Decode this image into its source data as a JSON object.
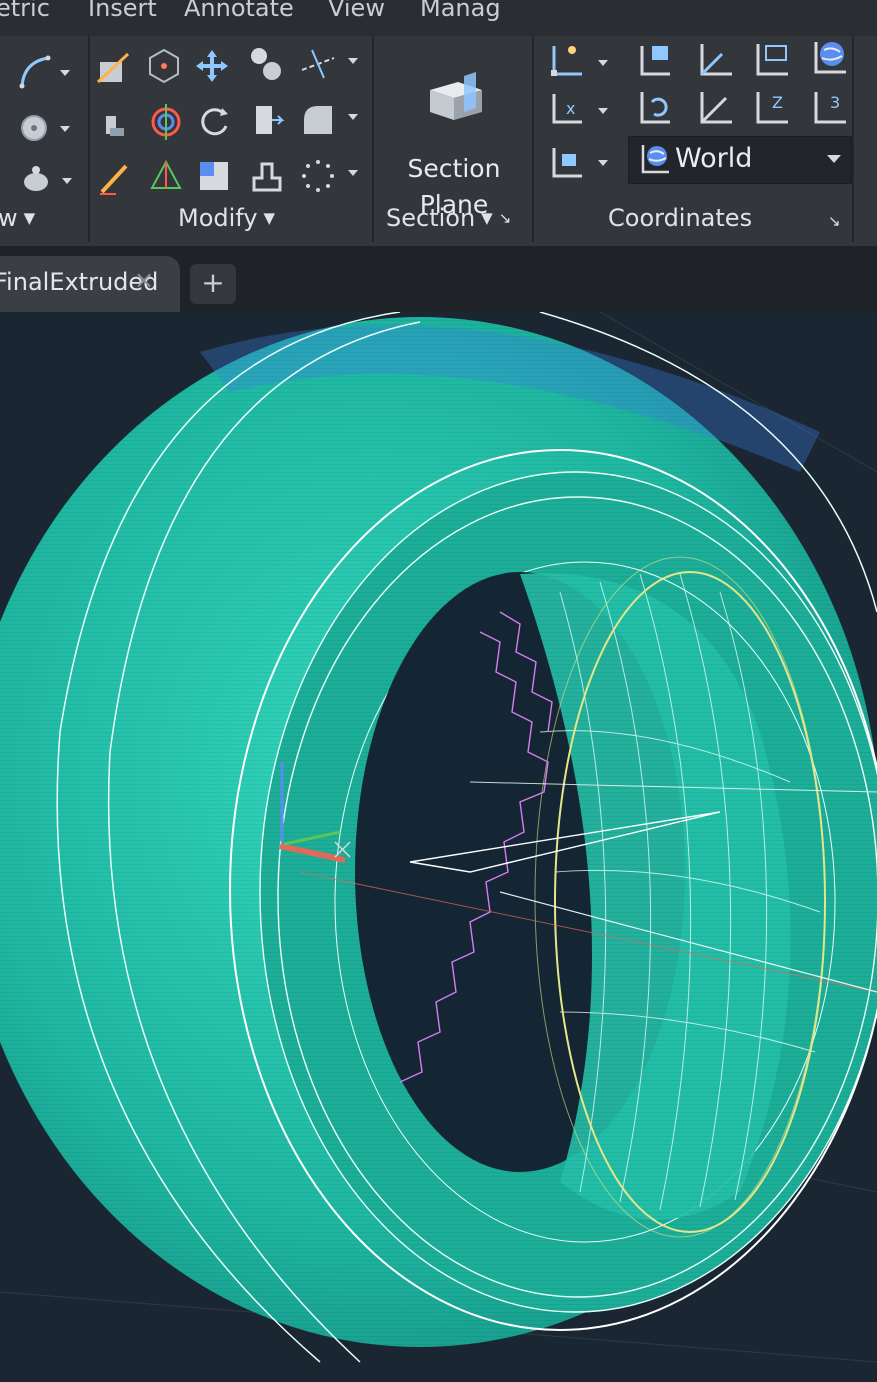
{
  "menu": {
    "tabs": [
      "etric",
      "Insert",
      "Annotate",
      "View",
      "Manag"
    ]
  },
  "ribbon": {
    "panels": {
      "view_partial": "w",
      "modify": "Modify",
      "section": "Section",
      "coordinates": "Coordinates"
    },
    "section_plane": {
      "line1": "Section",
      "line2": "Plane"
    },
    "ucs_select": {
      "value": "World"
    }
  },
  "document": {
    "tab_name": "FinalExtruded",
    "close_glyph": "×",
    "new_tab_glyph": "+"
  },
  "colors": {
    "tire_fill": "#1fb8a2",
    "wire": "#e8fff8",
    "accent_yellow": "#e5e58a",
    "accent_magenta": "#d77cf0",
    "axis_x": "#e06a5a",
    "axis_y": "#58c65a",
    "axis_z": "#5a8df0"
  }
}
